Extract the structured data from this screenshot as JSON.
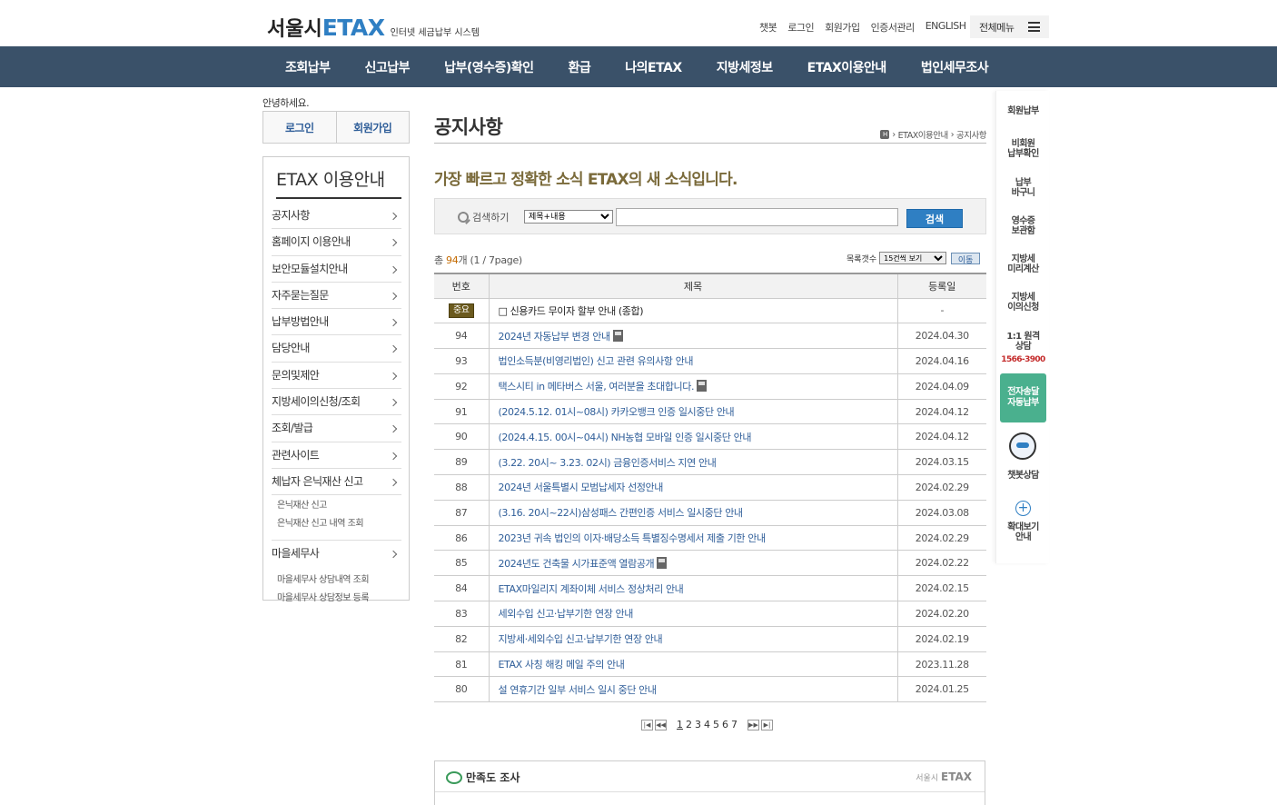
{
  "header": {
    "logo_seoul": "서울시",
    "logo_etax": "ETAX",
    "logo_sub": "인터넷 세금납부 시스템",
    "util_links": [
      "챗봇",
      "로그인",
      "회원가입",
      "인증서관리",
      "ENGLISH"
    ],
    "all_menu": "전체메뉴"
  },
  "gnb": [
    "조회납부",
    "신고납부",
    "납부(영수증)확인",
    "환급",
    "나의ETAX",
    "지방세정보",
    "ETAX이용안내",
    "법인세무조사"
  ],
  "sidebar": {
    "greeting": "안녕하세요.",
    "login": "로그인",
    "join": "회원가입",
    "title": "ETAX 이용안내",
    "items": [
      "공지사항",
      "홈페이지 이용안내",
      "보안모듈설치안내",
      "자주묻는질문",
      "납부방법안내",
      "담당안내",
      "문의및제안",
      "지방세이의신청/조회",
      "조회/발급",
      "관련사이트",
      "체납자 은닉재산 신고"
    ],
    "hidden_sub": [
      "은닉재산 신고",
      "은닉재산 신고 내역 조회"
    ],
    "village": "마을세무사",
    "village_sub": [
      "마을세무사 상담내역 조회",
      "마을세무사 상담정보 등록"
    ]
  },
  "content": {
    "title": "공지사항",
    "breadcrumb_home": "H",
    "breadcrumb": [
      "ETAX이용안내",
      "공지사항"
    ],
    "subtitle": "가장 빠르고 정확한 소식 ETAX의 새 소식입니다.",
    "search": {
      "label": "검색하기",
      "select_value": "제목+내용",
      "button": "검색"
    },
    "count_prefix": "총 ",
    "count_num": "94",
    "count_suffix": "개 (1 / 7page)",
    "list_label": "목록갯수",
    "list_select": "15건씩 보기",
    "list_button": "이동",
    "columns": [
      "번호",
      "제목",
      "등록일"
    ],
    "notice": {
      "badge": "중요",
      "title": "□ 신용카드 무이자 할부 안내 (종합)",
      "date": "-"
    },
    "rows": [
      {
        "no": "94",
        "title": "2024년 자동납부 변경 안내",
        "date": "2024.04.30",
        "file": true
      },
      {
        "no": "93",
        "title": "법인소득분(비영리법인) 신고 관련 유의사항 안내",
        "date": "2024.04.16",
        "file": false
      },
      {
        "no": "92",
        "title": "택스시티 in 메타버스 서울, 여러분을 초대합니다.",
        "date": "2024.04.09",
        "file": true
      },
      {
        "no": "91",
        "title": "(2024.5.12. 01시~08시) 카카오뱅크 인증 일시중단 안내",
        "date": "2024.04.12",
        "file": false
      },
      {
        "no": "90",
        "title": "(2024.4.15. 00시~04시) NH농협 모바일 인증 일시중단 안내",
        "date": "2024.04.12",
        "file": false
      },
      {
        "no": "89",
        "title": "(3.22. 20시~ 3.23. 02시) 금융인증서비스 지연 안내",
        "date": "2024.03.15",
        "file": false
      },
      {
        "no": "88",
        "title": "2024년 서울특별시 모범납세자 선정안내",
        "date": "2024.02.29",
        "file": false
      },
      {
        "no": "87",
        "title": "(3.16. 20시~22시)삼성패스 간편인증 서비스 일시중단 안내",
        "date": "2024.03.08",
        "file": false
      },
      {
        "no": "86",
        "title": "2023년 귀속 법인의 이자·배당소득 특별징수명세서 제출 기한 안내",
        "date": "2024.02.29",
        "file": false
      },
      {
        "no": "85",
        "title": "2024년도 건축물 시가표준액 열람공개",
        "date": "2024.02.22",
        "file": true
      },
      {
        "no": "84",
        "title": "ETAX마일리지 계좌이체 서비스 정상처리 안내",
        "date": "2024.02.15",
        "file": false
      },
      {
        "no": "83",
        "title": "세외수입 신고·납부기한 연장 안내",
        "date": "2024.02.20",
        "file": false
      },
      {
        "no": "82",
        "title": "지방세·세외수입 신고·납부기한 연장 안내",
        "date": "2024.02.19",
        "file": false
      },
      {
        "no": "81",
        "title": "ETAX 사칭 해킹 메일 주의 안내",
        "date": "2023.11.28",
        "file": false
      },
      {
        "no": "80",
        "title": "설 연휴기간 일부 서비스 일시 중단 안내",
        "date": "2024.01.25",
        "file": false
      }
    ],
    "pager": [
      "1",
      "2",
      "3",
      "4",
      "5",
      "6",
      "7"
    ],
    "survey_title": "만족도 조사",
    "survey_logo_pre": "서울시",
    "survey_logo": "ETAX"
  },
  "quick": {
    "items": [
      "회원납부",
      "비회원\n납부확인",
      "납부\n바구니",
      "영수증\n보관함",
      "지방세\n미리계산",
      "지방세\n이의신청",
      "1:1 원격\n상담"
    ],
    "tel": "1566-3900",
    "green": "전자송달\n자동납부",
    "chatbot": "챗봇상담",
    "zoom": "확대보기\n안내"
  }
}
